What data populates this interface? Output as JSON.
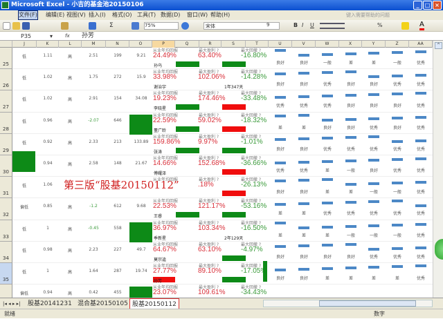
{
  "window": {
    "title": "Microsoft Excel - 小吉的基金池20150106"
  },
  "menu": {
    "items": [
      "文件(F)",
      "编辑(E)",
      "视图(V)",
      "插入(I)",
      "格式(O)",
      "工具(T)",
      "数据(D)",
      "窗口(W)",
      "帮助(H)"
    ],
    "help_placeholder": "键入需要帮助的问题"
  },
  "toolbar": {
    "zoom": "75%",
    "font": "宋体",
    "font_size": "9",
    "bold": "B",
    "italic": "I",
    "underline": "U",
    "percent": "%"
  },
  "formula": {
    "cell_ref": "P35",
    "fx": "fx",
    "value": "孙芳"
  },
  "columns": [
    "J",
    "K",
    "L",
    "M",
    "N",
    "O",
    "P",
    "Q",
    "R",
    "S",
    "T",
    "U",
    "V",
    "W",
    "X",
    "Y",
    "Z",
    "AA"
  ],
  "labels": {
    "avg_return": "从业年均回报",
    "max_profit": "最大盈利 ?",
    "max_drawdown": "最大回撤 ?"
  },
  "colors": {
    "green": "#0d8a17",
    "red": "#f00d0d",
    "rating_bar": "#4c88c6"
  },
  "rows": [
    {
      "num": "25",
      "j": "低",
      "k": "1.11",
      "l": "高",
      "m": "2.51",
      "n": "199",
      "o": "9.21",
      "ret": "24.49%",
      "profit": "63.40%",
      "dd": "-16.80%",
      "mgr": "孙乌",
      "q": "green",
      "s": "green",
      "ratings": [
        "良好",
        "良好",
        "一般",
        "差",
        "差",
        "一般",
        "优秀"
      ]
    },
    {
      "num": "26",
      "j": "低",
      "k": "1.02",
      "l": "高",
      "m": "1.75",
      "n": "272",
      "o": "15.9",
      "ret": "33.98%",
      "profit": "102.06%",
      "dd": "-14.28%",
      "mgr": "谢治宇",
      "q": "",
      "s": "",
      "s_text": "1年347天",
      "ratings": [
        "良好",
        "良好",
        "优秀",
        "良好",
        "良好",
        "优秀",
        "优秀"
      ]
    },
    {
      "num": "27",
      "j": "低",
      "k": "1.02",
      "l": "高",
      "m": "2.91",
      "n": "154",
      "o": "34.08",
      "ret": "19.23%",
      "profit": "174.46%",
      "dd": "-33.48%",
      "mgr": "李晓星",
      "q": "green",
      "s": "red",
      "ratings": [
        "优秀",
        "优秀",
        "优秀",
        "良好",
        "良好",
        "良好",
        "优秀"
      ]
    },
    {
      "num": "28",
      "j": "低",
      "k": "0.96",
      "l": "高",
      "m": "-2.07",
      "n": "646",
      "o": "",
      "o_green": true,
      "ret": "22.59%",
      "profit": "59.02%",
      "dd": "-18.32%",
      "mgr": "董广聆",
      "q": "green",
      "s": "red",
      "ratings": [
        "差",
        "差",
        "良好",
        "良好",
        "优秀",
        "良好",
        "优秀"
      ]
    },
    {
      "num": "29",
      "j": "低",
      "k": "0.92",
      "l": "高",
      "m": "2.33",
      "n": "213",
      "o": "133.89",
      "ret": "159.86%",
      "profit": "9.97%",
      "dd": "-1.01%",
      "mgr": "张涛",
      "q": "green",
      "s": "green",
      "ratings": [
        "良好",
        "良好",
        "优秀",
        "优秀",
        "优秀",
        "优秀",
        "优秀"
      ]
    },
    {
      "num": "30",
      "j": "",
      "j_green": true,
      "k": "0.94",
      "l": "高",
      "m": "2.58",
      "n": "148",
      "o": "21.67",
      "ret": "14.66%",
      "profit": "152.68%",
      "dd": "-36.66%",
      "mgr": "傅耀泽",
      "q": "",
      "s": "red",
      "ratings": [
        "优秀",
        "优秀",
        "差",
        "一般",
        "良好",
        "优秀",
        "优秀"
      ]
    },
    {
      "num": "31",
      "j": "低",
      "k": "1.06",
      "l": "",
      "m": "",
      "n": "",
      "o": "",
      "ret": "",
      "profit": ".18%",
      "dd": "-26.13%",
      "mgr": "",
      "q": "",
      "s": "red",
      "ratings": [
        "良好",
        "良好",
        "差",
        "差",
        "一般",
        "一般",
        "优秀"
      ]
    },
    {
      "num": "32",
      "j": "偏低",
      "k": "0.85",
      "l": "高",
      "m": "-1.2",
      "n": "612",
      "o": "9.68",
      "ret": "22.53%",
      "profit": "121.17%",
      "dd": "-53.16%",
      "mgr": "王睿",
      "q": "green",
      "s": "green",
      "ratings": [
        "差",
        "差",
        "优秀",
        "优秀",
        "优秀",
        "优秀",
        "优秀"
      ]
    },
    {
      "num": "33",
      "j": "低",
      "k": "1",
      "l": "高",
      "m": "-0.45",
      "n": "558",
      "o": "",
      "o_green": true,
      "ret": "36.97%",
      "profit": "103.34%",
      "dd": "-16.50%",
      "mgr": "季新星",
      "q": "",
      "s": "",
      "s_text": "2年129天",
      "ratings": [
        "差",
        "差",
        "差",
        "一般",
        "一般",
        "一般",
        "优秀"
      ]
    },
    {
      "num": "34",
      "j": "低",
      "k": "0.98",
      "l": "高",
      "m": "2.23",
      "n": "227",
      "o": "49.7",
      "ret": "64.67%",
      "profit": "63.10%",
      "dd": "-4.97%",
      "mgr": "莫宗逵",
      "q": "",
      "s": "green",
      "ratings": [
        "良好",
        "良好",
        "良好",
        "良好",
        "优秀",
        "优秀",
        "优秀"
      ]
    },
    {
      "num": "35",
      "j": "低",
      "k": "1",
      "l": "高",
      "m": "1.64",
      "n": "287",
      "o": "19.74",
      "ret": "27.77%",
      "profit": "89.10%",
      "dd": "-17.05%",
      "mgr": "孙芳",
      "p_red": true,
      "q": "",
      "s": "green",
      "ratings": [
        "良好",
        "良好",
        "差",
        "差",
        "差",
        "差",
        "优秀"
      ]
    },
    {
      "num": "36",
      "j": "偏低",
      "k": "0.94",
      "l": "高",
      "m": "0.42",
      "n": "455",
      "o": "",
      "o_green": true,
      "ret": "23.07%",
      "profit": "109.61%",
      "dd": "-34.43%",
      "mgr": "",
      "q": "",
      "s": "red",
      "ratings": []
    }
  ],
  "watermark": "第三版“股基20150112”",
  "sheets": [
    "股基20141231",
    "混合基20150105",
    "股基20150112"
  ],
  "active_sheet": "股基20150112",
  "status": {
    "ready": "就绪",
    "mode": "数字"
  }
}
